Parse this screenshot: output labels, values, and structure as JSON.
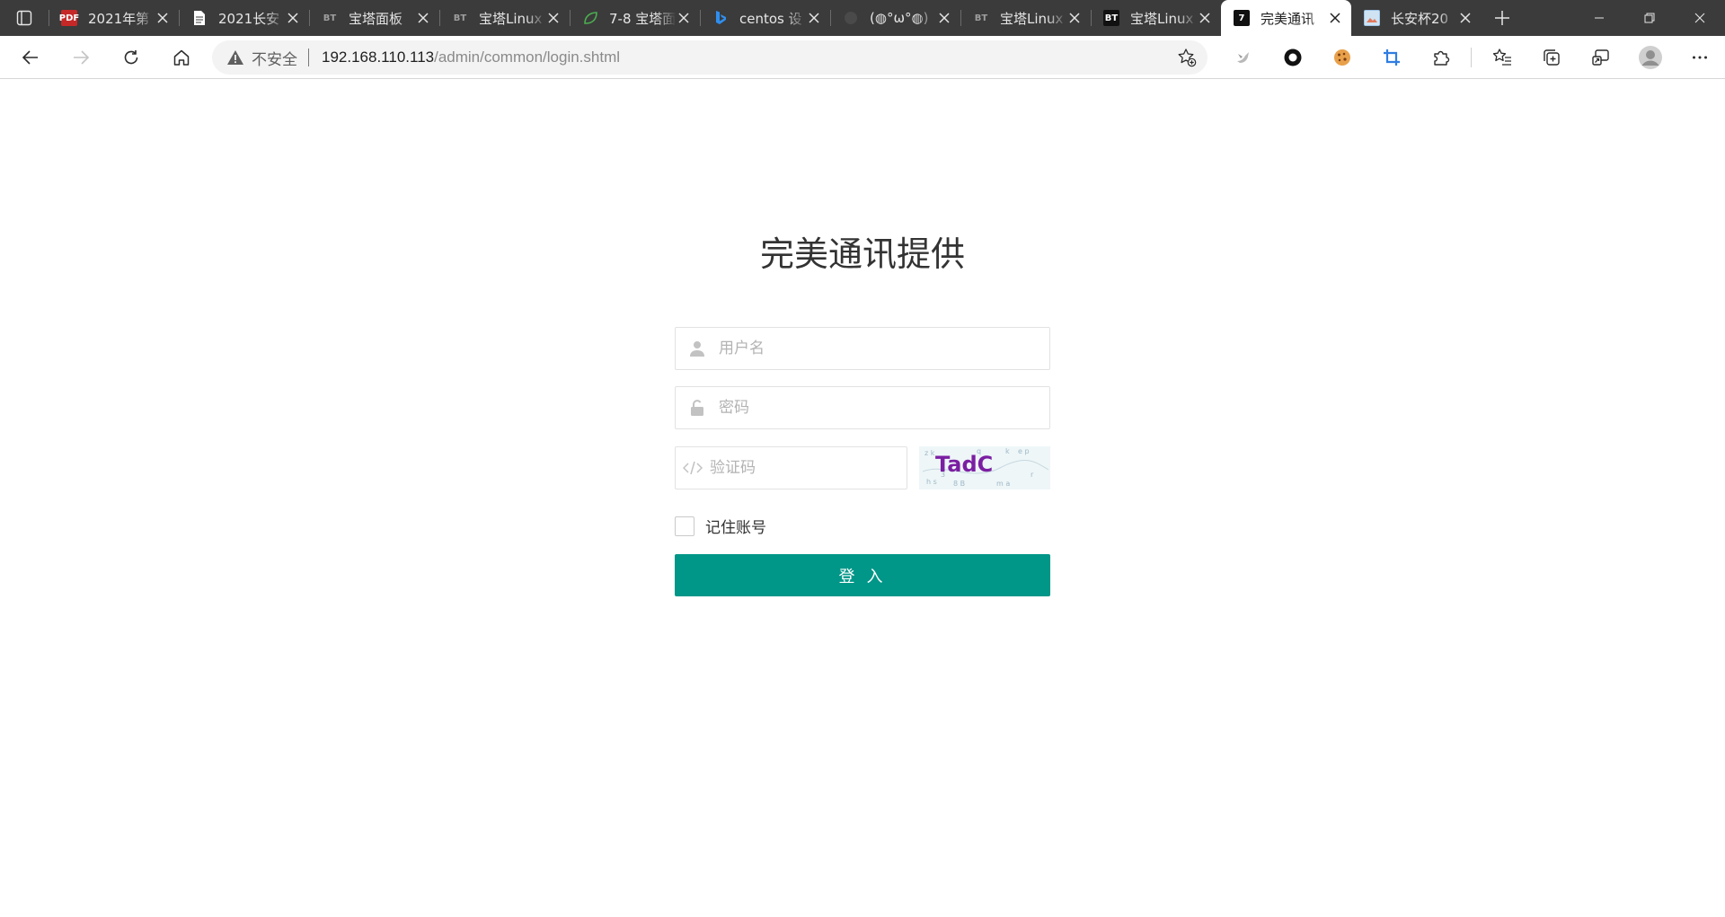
{
  "tabs": [
    {
      "title": "2021年第",
      "favicon": "pdf-icon",
      "fav_text": "PDF"
    },
    {
      "title": "2021长安",
      "favicon": "document-icon",
      "fav_text": ""
    },
    {
      "title": "宝塔面板",
      "favicon": "bt-icon",
      "fav_text": "BT"
    },
    {
      "title": "宝塔Linux",
      "favicon": "bt-icon",
      "fav_text": "BT"
    },
    {
      "title": "7-8 宝塔面",
      "favicon": "leaf-icon",
      "fav_text": ""
    },
    {
      "title": "centos 设",
      "favicon": "bing-icon",
      "fav_text": ""
    },
    {
      "title": "(◍°ω°◍)",
      "favicon": "face-icon",
      "fav_text": ""
    },
    {
      "title": "宝塔Linux",
      "favicon": "bt-icon",
      "fav_text": "BT"
    },
    {
      "title": "宝塔Linux",
      "favicon": "bt-icon-dark",
      "fav_text": "BT"
    },
    {
      "title": "完美通讯",
      "favicon": "terminal-icon",
      "fav_text": "7",
      "active": true
    },
    {
      "title": "长安杯20",
      "favicon": "image-icon",
      "fav_text": ""
    }
  ],
  "omnibox": {
    "security_text": "不安全",
    "url_host": "192.168.110.113",
    "url_path": "/admin/common/login.shtml"
  },
  "login": {
    "title": "完美通讯提供",
    "username_placeholder": "用户名",
    "password_placeholder": "密码",
    "captcha_placeholder": "验证码",
    "captcha_text": "TadC",
    "remember_label": "记住账号",
    "submit_label": "登 入"
  },
  "colors": {
    "primary_button": "#009688",
    "tabstrip_bg": "#3b3b3b",
    "captcha_text_color": "#7b1fa2"
  }
}
